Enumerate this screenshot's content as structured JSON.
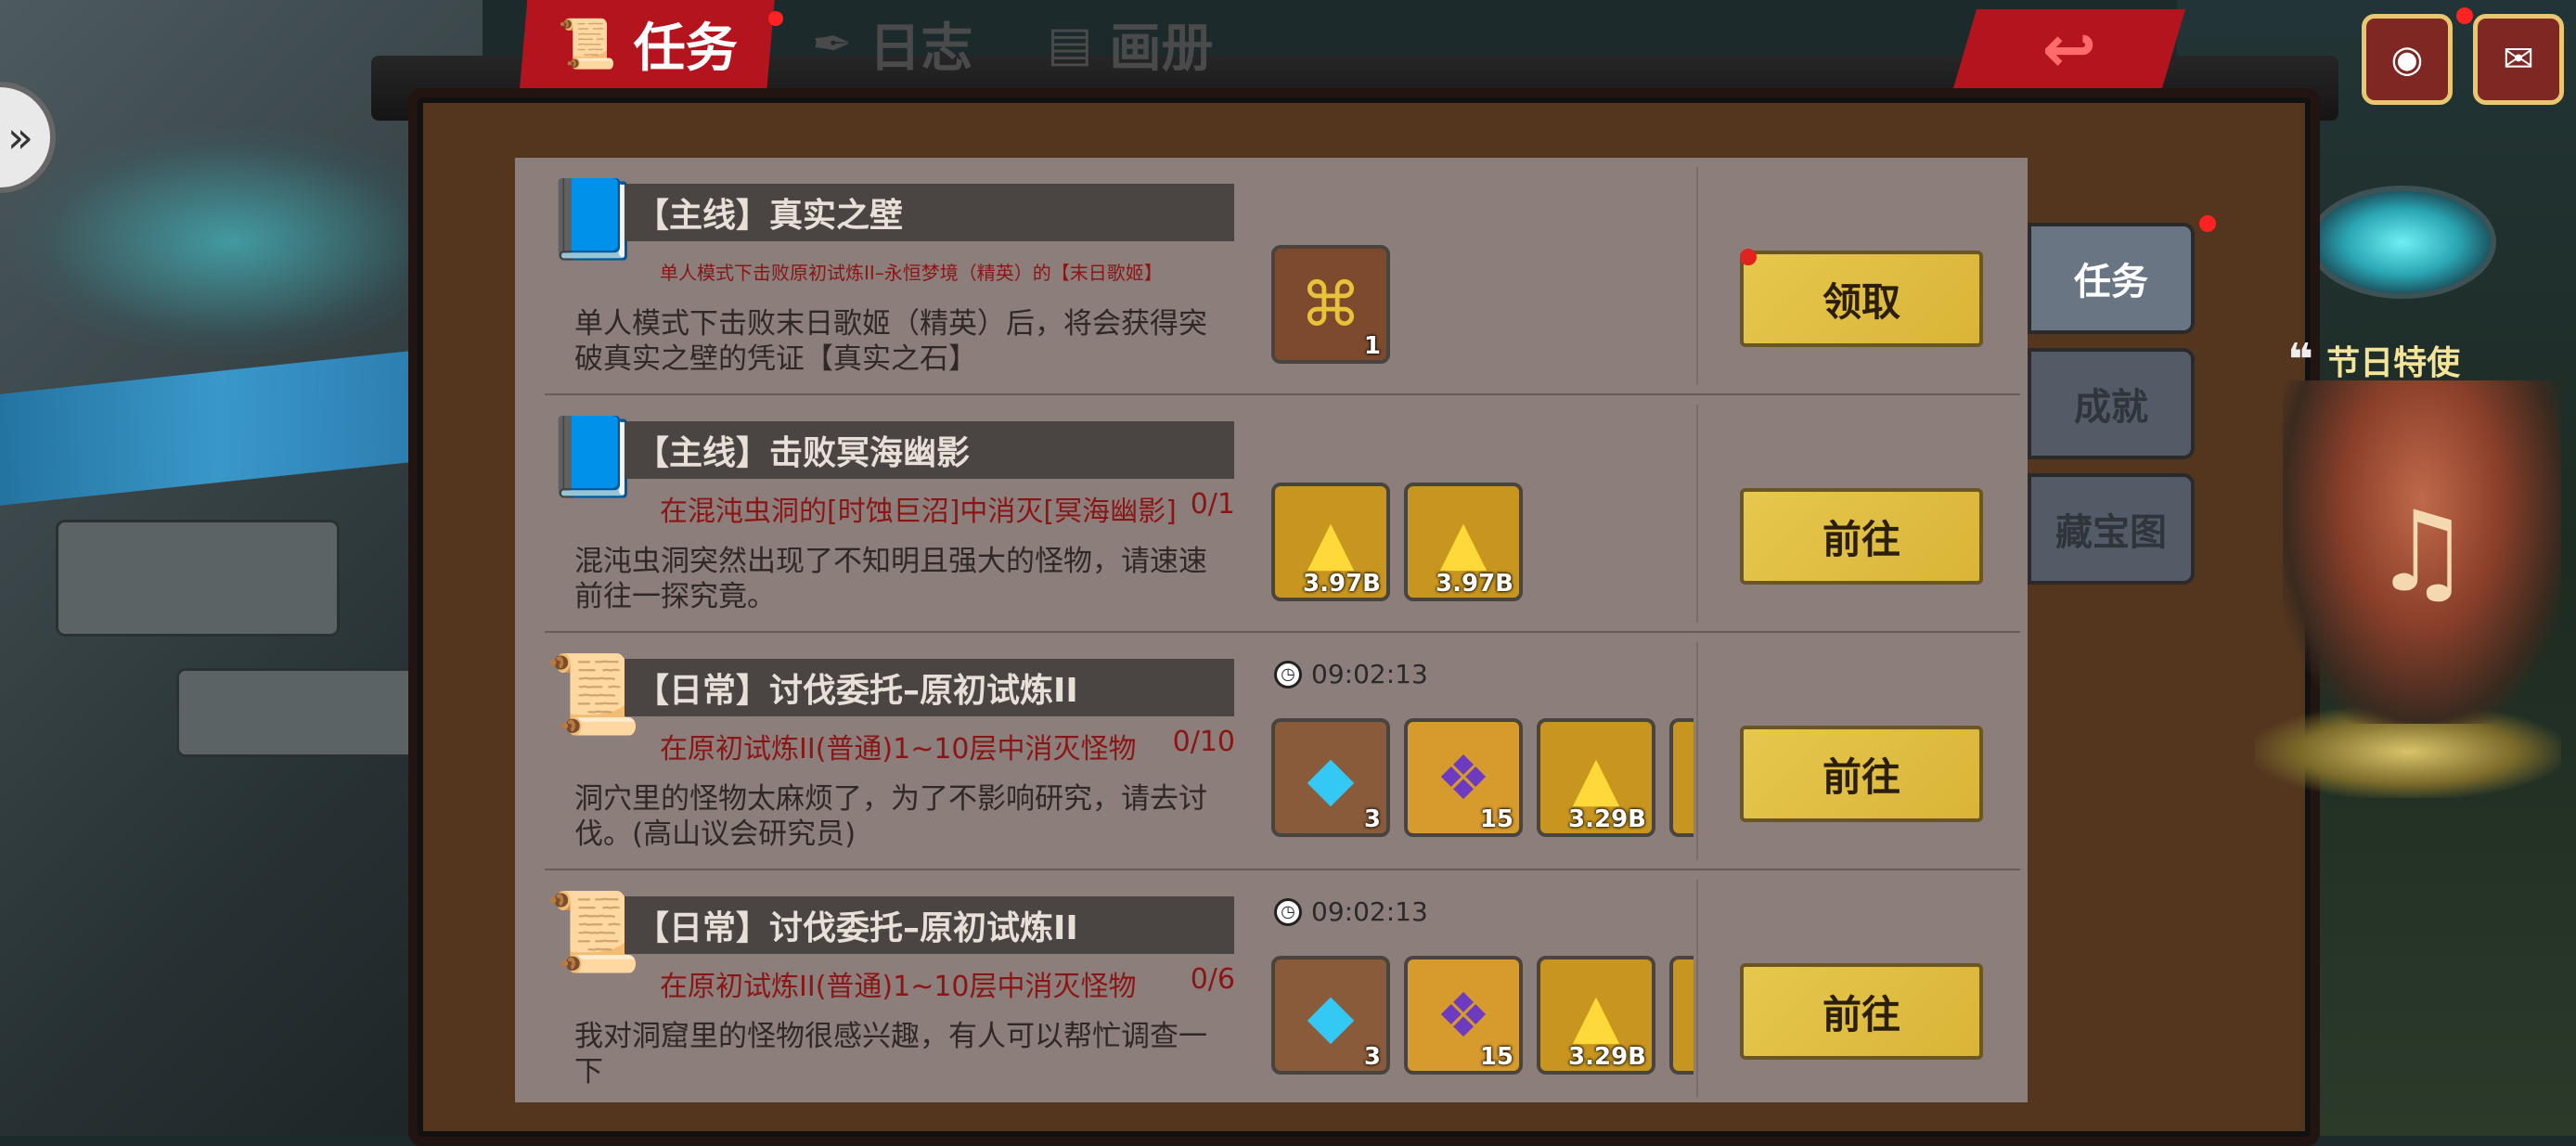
{
  "tabs": [
    {
      "label": "任务",
      "icon": "scroll-icon",
      "active": true
    },
    {
      "label": "日志",
      "icon": "quill-icon",
      "active": false
    },
    {
      "label": "画册",
      "icon": "album-icon",
      "active": false
    }
  ],
  "back_icon": "back-arrow-icon",
  "side_tabs": [
    {
      "label": "任务",
      "active": true
    },
    {
      "label": "成就",
      "active": false
    },
    {
      "label": "藏宝图",
      "active": false
    }
  ],
  "festival": {
    "label": "节日特使"
  },
  "quests": [
    {
      "icon": "book-icon",
      "title": "【主线】真实之壁",
      "objective": "单人模式下击败原初试炼II–永恒梦境（精英）的【末日歌姬】",
      "progress": "",
      "description": "单人模式下击败末日歌姬（精英）后，将会获得突破真实之壁的凭证【真实之石】",
      "timer": "",
      "rewards": [
        {
          "type": "rune-stone",
          "count": "1"
        }
      ],
      "action": "领取",
      "action_dot": true
    },
    {
      "icon": "book-icon",
      "title": "【主线】击败冥海幽影",
      "objective": "在混沌虫洞的[时蚀巨沼]中消灭[冥海幽影]",
      "progress": "0/1",
      "description": "混沌虫洞突然出现了不知明且强大的怪物，请速速前往一探究竟。",
      "timer": "",
      "rewards": [
        {
          "type": "gold-ingot",
          "count": "3.97B"
        },
        {
          "type": "gold-ingot",
          "count": "3.97B"
        }
      ],
      "action": "前往",
      "action_dot": false
    },
    {
      "icon": "scroll-icon",
      "title": "【日常】讨伐委托–原初试炼II",
      "objective": "在原初试炼II(普通)1~10层中消灭怪物",
      "progress": "0/10",
      "description": "洞穴里的怪物太麻烦了，为了不影响研究，请去讨伐。(高山议会研究员)",
      "timer": "09:02:13",
      "rewards": [
        {
          "type": "crystal",
          "count": "3"
        },
        {
          "type": "skill-book",
          "count": "15"
        },
        {
          "type": "gold-ingot",
          "count": "3.29B"
        },
        {
          "type": "gold-ingot",
          "count": ""
        }
      ],
      "action": "前往",
      "action_dot": false
    },
    {
      "icon": "scroll-icon",
      "title": "【日常】讨伐委托–原初试炼II",
      "objective": "在原初试炼II(普通)1~10层中消灭怪物",
      "progress": "0/6",
      "description": "我对洞窟里的怪物很感兴趣，有人可以帮忙调查一下",
      "timer": "09:02:13",
      "rewards": [
        {
          "type": "crystal",
          "count": "3"
        },
        {
          "type": "skill-book",
          "count": "15"
        },
        {
          "type": "gold-ingot",
          "count": "3.29B"
        },
        {
          "type": "gold-ingot",
          "count": ""
        }
      ],
      "action": "前往",
      "action_dot": false
    }
  ]
}
